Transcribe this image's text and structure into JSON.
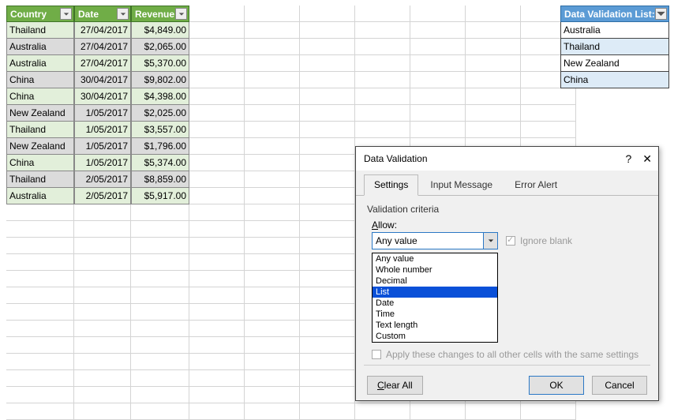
{
  "table": {
    "headers": [
      "Country",
      "Date",
      "Revenue"
    ],
    "rows": [
      [
        "Thailand",
        "27/04/2017",
        "$4,849.00"
      ],
      [
        "Australia",
        "27/04/2017",
        "$2,065.00"
      ],
      [
        "Australia",
        "27/04/2017",
        "$5,370.00"
      ],
      [
        "China",
        "30/04/2017",
        "$9,802.00"
      ],
      [
        "China",
        "30/04/2017",
        "$4,398.00"
      ],
      [
        "New Zealand",
        "1/05/2017",
        "$2,025.00"
      ],
      [
        "Thailand",
        "1/05/2017",
        "$3,557.00"
      ],
      [
        "New Zealand",
        "1/05/2017",
        "$1,796.00"
      ],
      [
        "China",
        "1/05/2017",
        "$5,374.00"
      ],
      [
        "Thailand",
        "2/05/2017",
        "$8,859.00"
      ],
      [
        "Australia",
        "2/05/2017",
        "$5,917.00"
      ]
    ]
  },
  "validationList": {
    "header": "Data Validation List:",
    "items": [
      "Australia",
      "Thailand",
      "New Zealand",
      "China"
    ]
  },
  "dialog": {
    "title": "Data Validation",
    "tabs": [
      "Settings",
      "Input Message",
      "Error Alert"
    ],
    "criteriaLabel": "Validation criteria",
    "allowLabel": "Allow:",
    "allowValue": "Any value",
    "allowOptions": [
      "Any value",
      "Whole number",
      "Decimal",
      "List",
      "Date",
      "Time",
      "Text length",
      "Custom"
    ],
    "allowSelectedIndex": 3,
    "ignoreBlank": "Ignore blank",
    "applyAll": "Apply these changes to all other cells with the same settings",
    "clearAll": "Clear All",
    "ok": "OK",
    "cancel": "Cancel"
  }
}
